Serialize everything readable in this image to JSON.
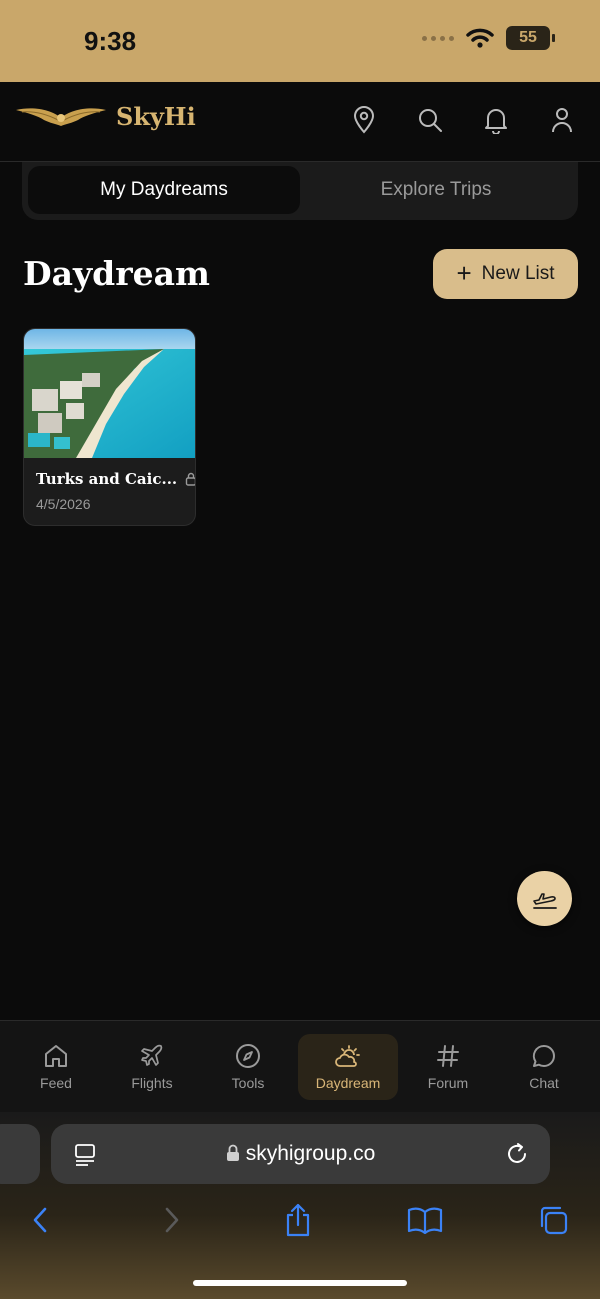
{
  "status": {
    "time": "9:38",
    "battery": "55"
  },
  "header": {
    "brand": "SkyHi"
  },
  "tabs": {
    "active": "My Daydreams",
    "inactive": "Explore Trips"
  },
  "page": {
    "title": "Daydream",
    "new_list_label": "New List"
  },
  "cards": [
    {
      "title": "Turks and Caic...",
      "date": "4/5/2026"
    }
  ],
  "nav": [
    {
      "label": "Feed",
      "icon": "home-icon"
    },
    {
      "label": "Flights",
      "icon": "plane-icon"
    },
    {
      "label": "Tools",
      "icon": "compass-icon"
    },
    {
      "label": "Daydream",
      "icon": "sun-cloud-icon"
    },
    {
      "label": "Forum",
      "icon": "hash-icon"
    },
    {
      "label": "Chat",
      "icon": "chat-bubble-icon"
    }
  ],
  "browser": {
    "url": "skyhigroup.co"
  },
  "colors": {
    "accent": "#d9bd8b",
    "status_bar": "#c9a76a",
    "background": "#0b0b0b",
    "browser_blue": "#3b82f6"
  }
}
